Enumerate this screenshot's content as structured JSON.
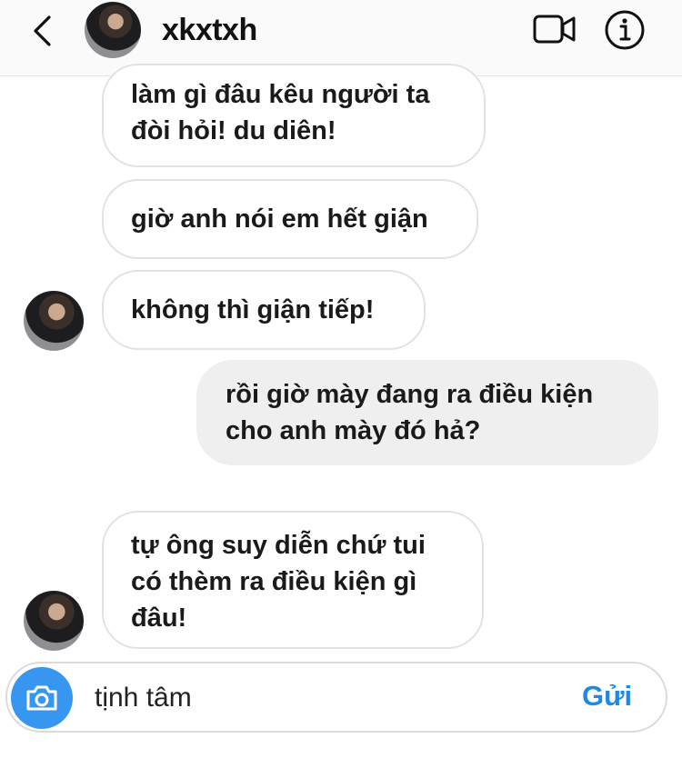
{
  "header": {
    "username": "xkxtxh",
    "icons": {
      "back": "chevron-left-icon",
      "video": "video-call-icon",
      "info": "info-icon"
    }
  },
  "messages": [
    {
      "sender": "them",
      "lines": [
        "làm gì đâu kêu người ta",
        "đòi hỏi! du diên!"
      ]
    },
    {
      "sender": "them",
      "lines": [
        "giờ anh nói em hết giận"
      ]
    },
    {
      "sender": "them",
      "lines": [
        "không thì giận tiếp!"
      ]
    },
    {
      "sender": "me",
      "lines": [
        "rồi giờ mày đang ra điều kiện",
        "cho anh mày đó hả?"
      ]
    },
    {
      "sender": "them",
      "lines": [
        "tự ông suy diễn chứ tui",
        "có thèm ra điều kiện gì",
        "đâu!"
      ]
    }
  ],
  "composer": {
    "input_value": "tịnh tâm",
    "send_label": "Gửi",
    "camera_icon": "camera-icon"
  },
  "colors": {
    "accent": "#1f8ae6",
    "camera": "#3797f0",
    "my_bubble": "#efefef"
  }
}
